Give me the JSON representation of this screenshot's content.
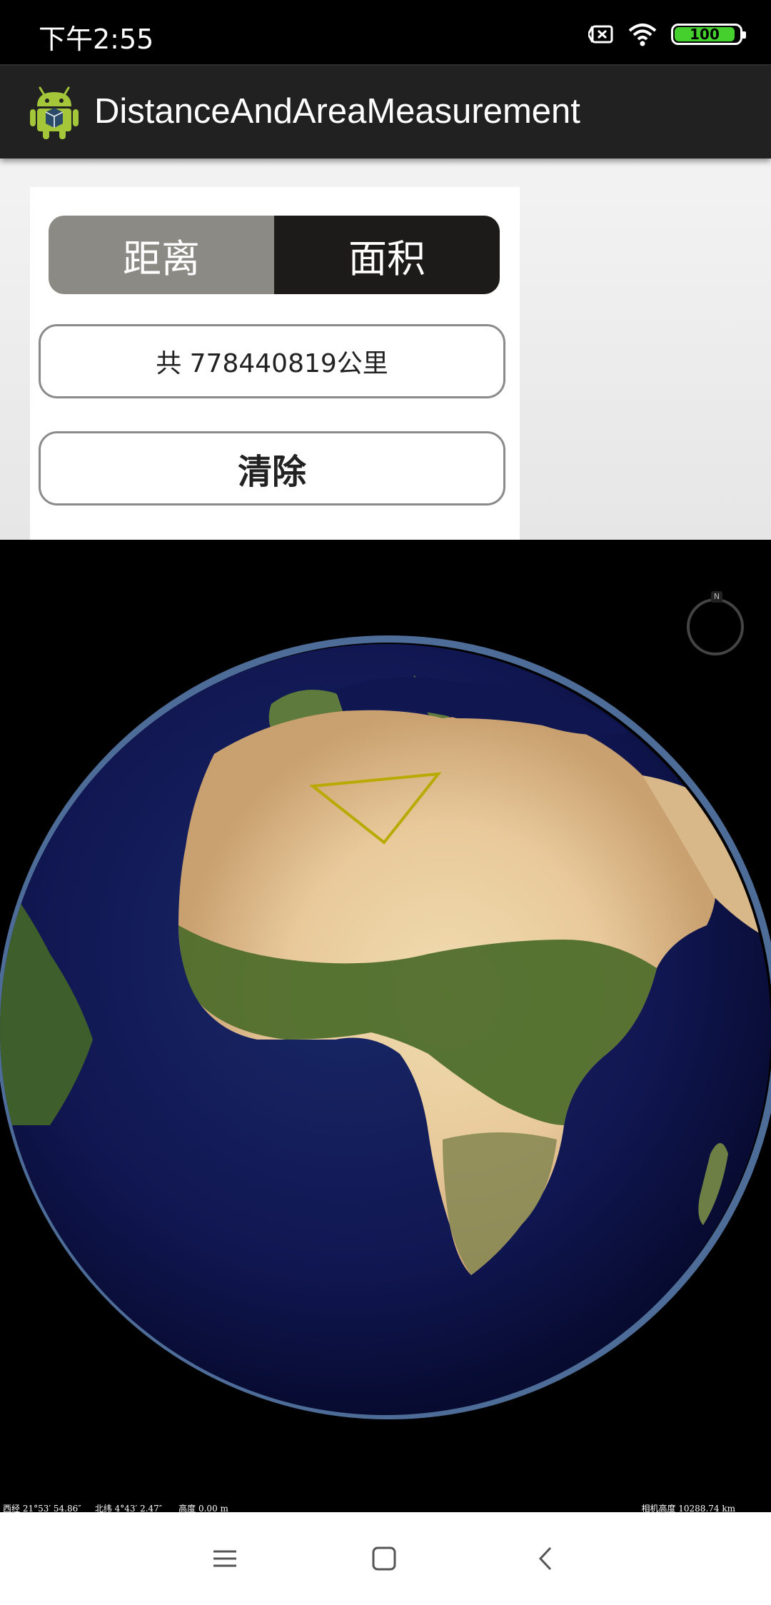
{
  "status_bar": {
    "time": "下午2:55",
    "battery": "100",
    "icons": [
      "notification-x-icon",
      "wifi-icon",
      "battery-icon"
    ]
  },
  "action_bar": {
    "title": "DistanceAndAreaMeasurement",
    "icon": "android-icon"
  },
  "mode_toggle": {
    "distance_label": "距离",
    "area_label": "面积",
    "selected": "面积"
  },
  "result": {
    "text": "共 778440819公里"
  },
  "clear_button": {
    "label": "清除"
  },
  "globe_info": {
    "longitude": "西经 21°53′ 54.86″",
    "latitude": "北纬 4°43′ 2.47″",
    "altitude": "高度 0.00 m",
    "camera_height": "相机高度 10288.74 km",
    "compass_label": "N"
  },
  "colors": {
    "polygon_stroke": "#b8aa00",
    "segment_inactive": "#8c8a84",
    "segment_active": "#1c1b19",
    "battery_green": "#45d02d"
  },
  "nav_bar": {
    "icons": [
      "menu-icon",
      "home-icon",
      "back-icon"
    ]
  }
}
